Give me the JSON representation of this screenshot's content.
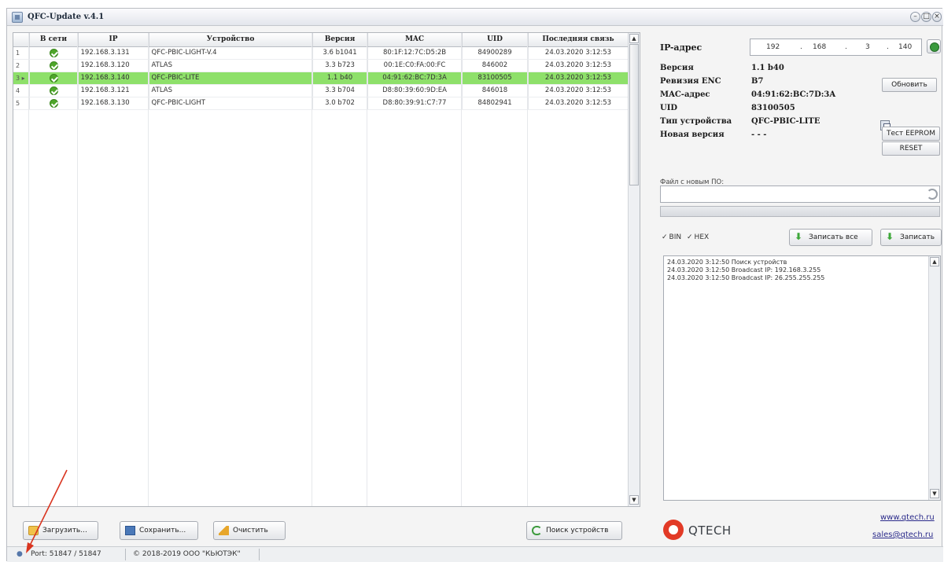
{
  "window": {
    "title": "QFC-Update v.4.1"
  },
  "grid": {
    "columns": [
      "",
      "В сети",
      "IP",
      "Устройство",
      "Версия",
      "MAC",
      "UID",
      "Последняя связь"
    ],
    "rows": [
      {
        "num": "1",
        "ip": "192.168.3.131",
        "device": "QFC-PBIC-LIGHT-V.4",
        "version": "3.6 b1041",
        "mac": "80:1F:12:7C:D5:2B",
        "uid": "84900289",
        "last": "24.03.2020 3:12:53"
      },
      {
        "num": "2",
        "ip": "192.168.3.120",
        "device": "ATLAS",
        "version": "3.3 b723",
        "mac": "00:1E:C0:FA:00:FC",
        "uid": "846002",
        "last": "24.03.2020 3:12:53"
      },
      {
        "num": "3 ▸",
        "ip": "192.168.3.140",
        "device": "QFC-PBIC-LITE",
        "version": "1.1 b40",
        "mac": "04:91:62:BC:7D:3A",
        "uid": "83100505",
        "last": "24.03.2020 3:12:53",
        "selected": true
      },
      {
        "num": "4",
        "ip": "192.168.3.121",
        "device": "ATLAS",
        "version": "3.3 b704",
        "mac": "D8:80:39:60:9D:EA",
        "uid": "846018",
        "last": "24.03.2020 3:12:53"
      },
      {
        "num": "5",
        "ip": "192.168.3.130",
        "device": "QFC-PBIC-LIGHT",
        "version": "3.0 b702",
        "mac": "D8:80:39:91:C7:77",
        "uid": "84802941",
        "last": "24.03.2020 3:12:53"
      }
    ]
  },
  "buttons": {
    "load": "Загрузить...",
    "save": "Сохранить...",
    "clear": "Очистить",
    "search": "Поиск устройств"
  },
  "status": {
    "port": "Port: 51847 / 51847",
    "copyright": "© 2018-2019 ООО \"КЬЮТЭК\""
  },
  "panel": {
    "ip_label": "IP-адрес",
    "ip": [
      "192",
      "168",
      "3",
      "140"
    ],
    "version_label": "Версия",
    "version": "1.1 b40",
    "enc_label": "Ревизия ENC",
    "enc": "B7",
    "mac_label": "MAC-адрес",
    "mac": "04:91:62:BC:7D:3A",
    "uid_label": "UID",
    "uid": "83100505",
    "type_label": "Тип устройства",
    "type": "QFC-PBIC-LITE",
    "newver_label": "Новая версия",
    "newver": "- - -",
    "update_btn": "Обновить",
    "eeprom_btn": "Тест EEPROM",
    "reset_btn": "RESET",
    "file_label": "Файл с новым ПО:",
    "bin": "BIN",
    "hex": "HEX",
    "write_all_btn": "Записать все",
    "write_btn": "Записать",
    "log": [
      "24.03.2020 3:12:50 Поиск устройств",
      "24.03.2020 3:12:50 Broadcast IP: 192.168.3.255",
      "24.03.2020 3:12:50 Broadcast IP: 26.255.255.255"
    ],
    "logo": "QTECH",
    "site": "www.qtech.ru",
    "email": "sales@qtech.ru"
  },
  "colors": {
    "selected_row": "#8ee06a",
    "online": "#4ea62a",
    "logo": "#e23a26"
  }
}
